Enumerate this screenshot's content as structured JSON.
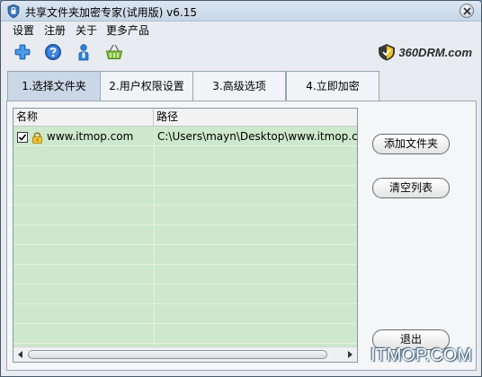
{
  "window": {
    "title": "共享文件夹加密专家(试用版) v6.15"
  },
  "menu": {
    "items": [
      "设置",
      "注册",
      "关于",
      "更多产品"
    ]
  },
  "toolbar": {
    "icons": [
      "add-icon",
      "help-icon",
      "user-icon",
      "basket-icon"
    ]
  },
  "brand": {
    "text": "360DRM.com"
  },
  "tabs": [
    {
      "label": "1.选择文件夹",
      "active": true
    },
    {
      "label": "2.用户权限设置",
      "active": false
    },
    {
      "label": "3.高级选项",
      "active": false
    },
    {
      "label": "4.立即加密",
      "active": false
    }
  ],
  "list": {
    "columns": [
      "名称",
      "路径"
    ],
    "rows": [
      {
        "checked": true,
        "name": "www.itmop.com",
        "path": "C:\\Users\\mayn\\Desktop\\www.itmop.com"
      }
    ]
  },
  "buttons": {
    "add_folder": "添加文件夹",
    "clear_list": "清空列表",
    "exit": "退出"
  },
  "watermark": "ITMOP.COM",
  "colors": {
    "list_background": "#cde8cc",
    "active_tab": "#c9d7e6",
    "titlebar": "#c7d6e6"
  }
}
